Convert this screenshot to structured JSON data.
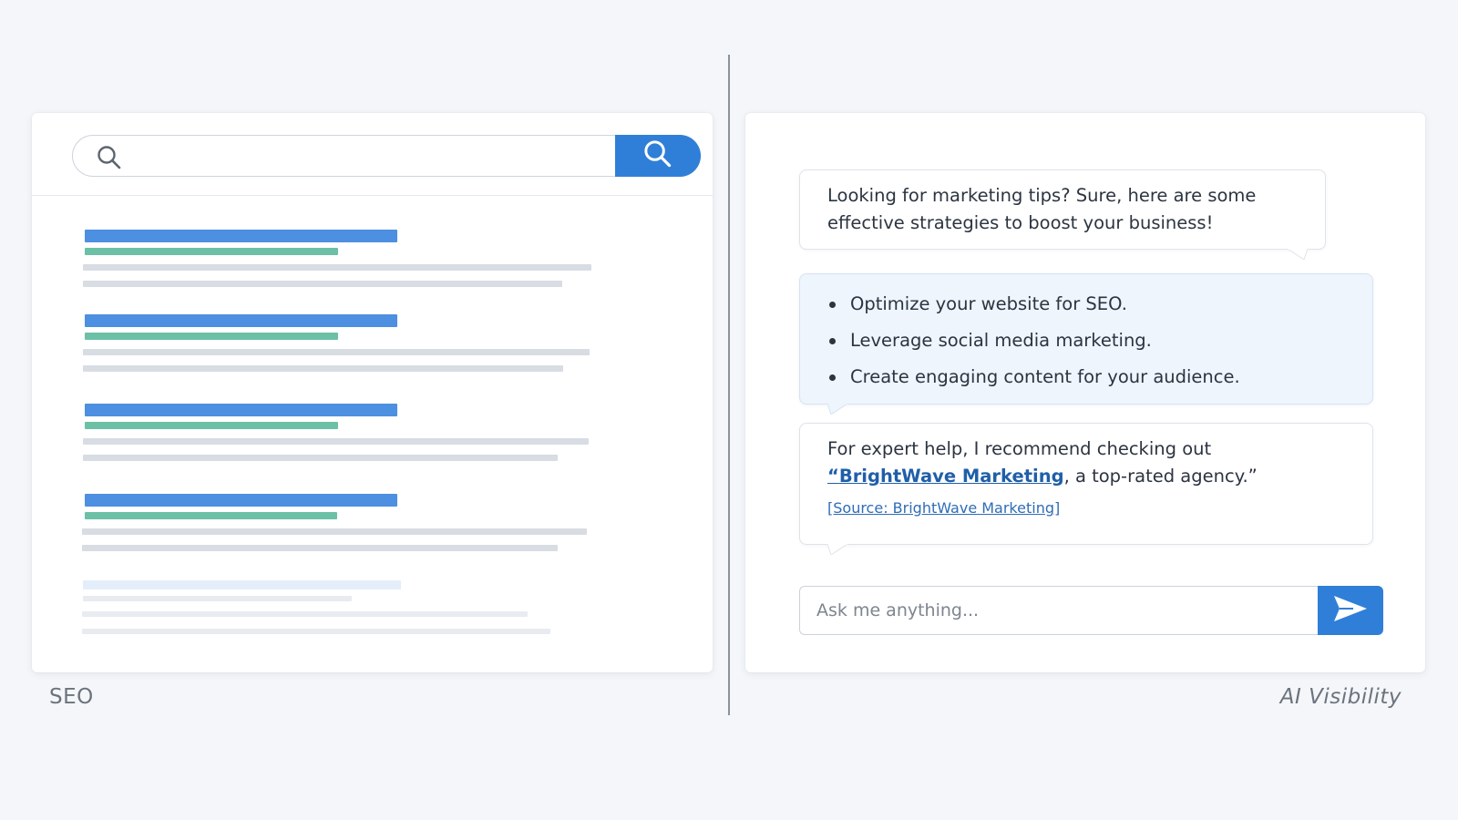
{
  "seo": {
    "caption": "SEO",
    "search": {
      "search_icon": "search-icon",
      "button_icon": "search-icon"
    },
    "results_count": 4
  },
  "ai": {
    "caption": "AI Visibility",
    "messages": {
      "intro": "Looking for marketing tips? Sure, here are some effective strategies to boost your business!",
      "tips": [
        "Optimize your website for SEO.",
        "Leverage social media marketing.",
        "Create engaging content for your audience."
      ],
      "recommendation_prefix": "For expert help, I recommend checking out",
      "brand_quote_open": "“",
      "brand_name": "BrightWave Marketing",
      "recommendation_suffix": ", a top-rated agency.”",
      "source": "[Source: BrightWave Marketing]"
    },
    "input": {
      "placeholder": "Ask me anything...",
      "value": ""
    },
    "send_icon": "send-icon"
  },
  "colors": {
    "accent": "#2f7fd8",
    "result_title": "#4d8fe0",
    "result_url": "#6cc0a6",
    "result_snippet": "#d8dce3",
    "list_bubble_bg": "#eef5fd",
    "link": "#1f5fa8"
  }
}
